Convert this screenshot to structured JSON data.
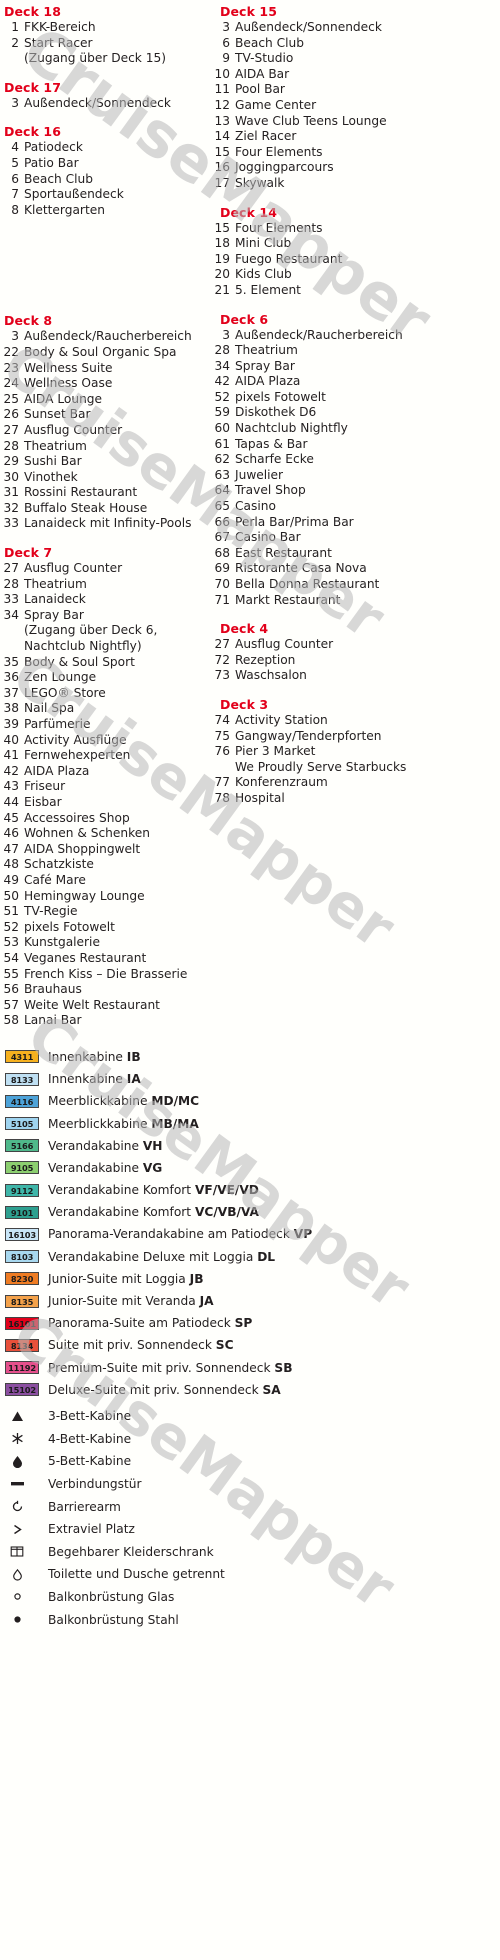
{
  "watermark": {
    "text": "CruiseMapper"
  },
  "colors": {
    "deck_heading": "#e2001a",
    "body_text": "#231f20",
    "background": "#fffffc"
  },
  "left_column": {
    "decks": [
      {
        "title": "Deck 18",
        "items": [
          {
            "num": "1",
            "label": "FKK-Bereich"
          },
          {
            "num": "2",
            "label": "Start Racer"
          },
          {
            "num": "",
            "label": "(Zugang über Deck 15)"
          }
        ]
      },
      {
        "title": "Deck 17",
        "items": [
          {
            "num": "3",
            "label": "Außendeck/Sonnendeck"
          }
        ]
      },
      {
        "title": "Deck 16",
        "items": [
          {
            "num": "4",
            "label": "Patiodeck"
          },
          {
            "num": "5",
            "label": "Patio Bar"
          },
          {
            "num": "6",
            "label": "Beach Club"
          },
          {
            "num": "7",
            "label": "Sportaußendeck"
          },
          {
            "num": "8",
            "label": "Klettergarten"
          }
        ]
      },
      {
        "title": "Deck 8",
        "items": [
          {
            "num": "3",
            "label": "Außendeck/Raucherbereich"
          },
          {
            "num": "22",
            "label": "Body & Soul Organic Spa"
          },
          {
            "num": "23",
            "label": "Wellness Suite"
          },
          {
            "num": "24",
            "label": "Wellness Oase"
          },
          {
            "num": "25",
            "label": "AIDA Lounge"
          },
          {
            "num": "26",
            "label": "Sunset Bar"
          },
          {
            "num": "27",
            "label": "Ausflug Counter"
          },
          {
            "num": "28",
            "label": "Theatrium"
          },
          {
            "num": "29",
            "label": "Sushi Bar"
          },
          {
            "num": "30",
            "label": "Vinothek"
          },
          {
            "num": "31",
            "label": "Rossini Restaurant"
          },
          {
            "num": "32",
            "label": "Buffalo Steak House"
          },
          {
            "num": "33",
            "label": "Lanaideck mit Infinity-Pools"
          }
        ]
      },
      {
        "title": "Deck 7",
        "items": [
          {
            "num": "27",
            "label": "Ausflug Counter"
          },
          {
            "num": "28",
            "label": "Theatrium"
          },
          {
            "num": "33",
            "label": "Lanaideck"
          },
          {
            "num": "34",
            "label": "Spray Bar"
          },
          {
            "num": "",
            "label": "(Zugang über Deck 6,"
          },
          {
            "num": "",
            "label": "Nachtclub Nightfly)"
          },
          {
            "num": "35",
            "label": "Body & Soul Sport"
          },
          {
            "num": "36",
            "label": "Zen Lounge"
          },
          {
            "num": "37",
            "label": "LEGO® Store"
          },
          {
            "num": "38",
            "label": "Nail Spa"
          },
          {
            "num": "39",
            "label": "Parfümerie"
          },
          {
            "num": "40",
            "label": "Activity Ausflüge"
          },
          {
            "num": "41",
            "label": "Fernwehexperten"
          },
          {
            "num": "42",
            "label": "AIDA Plaza"
          },
          {
            "num": "43",
            "label": "Friseur"
          },
          {
            "num": "44",
            "label": "Eisbar"
          },
          {
            "num": "45",
            "label": "Accessoires Shop"
          },
          {
            "num": "46",
            "label": "Wohnen & Schenken"
          },
          {
            "num": "47",
            "label": "AIDA Shoppingwelt"
          },
          {
            "num": "48",
            "label": "Schatzkiste"
          },
          {
            "num": "49",
            "label": "Café Mare"
          },
          {
            "num": "50",
            "label": "Hemingway Lounge"
          },
          {
            "num": "51",
            "label": "TV-Regie"
          },
          {
            "num": "52",
            "label": "pixels Fotowelt"
          },
          {
            "num": "53",
            "label": "Kunstgalerie"
          },
          {
            "num": "54",
            "label": "Veganes Restaurant"
          },
          {
            "num": "55",
            "label": "French Kiss – Die Brasserie"
          },
          {
            "num": "56",
            "label": "Brauhaus"
          },
          {
            "num": "57",
            "label": "Weite Welt Restaurant"
          },
          {
            "num": "58",
            "label": "Lanai Bar"
          }
        ]
      }
    ]
  },
  "right_column": {
    "decks": [
      {
        "title": "Deck 15",
        "items": [
          {
            "num": "3",
            "label": "Außendeck/Sonnendeck"
          },
          {
            "num": "6",
            "label": "Beach Club"
          },
          {
            "num": "9",
            "label": "TV-Studio"
          },
          {
            "num": "10",
            "label": "AIDA Bar"
          },
          {
            "num": "11",
            "label": "Pool Bar"
          },
          {
            "num": "12",
            "label": "Game Center"
          },
          {
            "num": "13",
            "label": "Wave Club Teens Lounge"
          },
          {
            "num": "14",
            "label": "Ziel Racer"
          },
          {
            "num": "15",
            "label": "Four Elements"
          },
          {
            "num": "16",
            "label": "Joggingparcours"
          },
          {
            "num": "17",
            "label": "Skywalk"
          }
        ]
      },
      {
        "title": "Deck 14",
        "items": [
          {
            "num": "15",
            "label": "Four Elements"
          },
          {
            "num": "18",
            "label": "Mini Club"
          },
          {
            "num": "19",
            "label": "Fuego Restaurant"
          },
          {
            "num": "20",
            "label": "Kids Club"
          },
          {
            "num": "21",
            "label": "5. Element"
          }
        ]
      },
      {
        "title": "Deck 6",
        "items": [
          {
            "num": "3",
            "label": "Außendeck/Raucherbereich"
          },
          {
            "num": "28",
            "label": "Theatrium"
          },
          {
            "num": "34",
            "label": "Spray Bar"
          },
          {
            "num": "42",
            "label": "AIDA Plaza"
          },
          {
            "num": "52",
            "label": "pixels Fotowelt"
          },
          {
            "num": "59",
            "label": "Diskothek D6"
          },
          {
            "num": "60",
            "label": "Nachtclub Nightfly"
          },
          {
            "num": "61",
            "label": "Tapas & Bar"
          },
          {
            "num": "62",
            "label": "Scharfe Ecke"
          },
          {
            "num": "63",
            "label": "Juwelier"
          },
          {
            "num": "64",
            "label": "Travel Shop"
          },
          {
            "num": "65",
            "label": "Casino"
          },
          {
            "num": "66",
            "label": "Perla Bar/Prima Bar"
          },
          {
            "num": "67",
            "label": "Casino Bar"
          },
          {
            "num": "68",
            "label": "East Restaurant"
          },
          {
            "num": "69",
            "label": "Ristorante Casa Nova"
          },
          {
            "num": "70",
            "label": "Bella Donna Restaurant"
          },
          {
            "num": "71",
            "label": "Markt Restaurant"
          }
        ]
      },
      {
        "title": "Deck 4",
        "items": [
          {
            "num": "27",
            "label": "Ausflug Counter"
          },
          {
            "num": "72",
            "label": "Rezeption"
          },
          {
            "num": "73",
            "label": "Waschsalon"
          }
        ]
      },
      {
        "title": "Deck 3",
        "items": [
          {
            "num": "74",
            "label": "Activity Station"
          },
          {
            "num": "75",
            "label": "Gangway/Tenderpforten"
          },
          {
            "num": "76",
            "label": "Pier 3 Market"
          },
          {
            "num": "",
            "label": "We Proudly Serve Starbucks"
          },
          {
            "num": "77",
            "label": "Konferenzraum"
          },
          {
            "num": "78",
            "label": "Hospital"
          }
        ]
      }
    ]
  },
  "cabin_legend": [
    {
      "code": "4311",
      "color": "#f6b11e",
      "text": "Innenkabine ",
      "bold": "IB"
    },
    {
      "code": "8133",
      "color": "#bfe0f2",
      "text": "Innenkabine ",
      "bold": "IA"
    },
    {
      "code": "4116",
      "color": "#4da3d8",
      "text": "Meerblickkabine ",
      "bold": "MD/MC"
    },
    {
      "code": "5105",
      "color": "#9fd4ef",
      "text": "Meerblickkabine ",
      "bold": "MB/MA"
    },
    {
      "code": "5166",
      "color": "#4fb98a",
      "text": "Verandakabine ",
      "bold": "VH"
    },
    {
      "code": "9105",
      "color": "#8ccf6f",
      "text": "Verandakabine ",
      "bold": "VG"
    },
    {
      "code": "9112",
      "color": "#3fb6a8",
      "text": "Verandakabine Komfort ",
      "bold": "VF/VE/VD"
    },
    {
      "code": "9101",
      "color": "#2ea08f",
      "text": "Verandakabine Komfort ",
      "bold": "VC/VB/VA"
    },
    {
      "code": "16103",
      "color": "#c9e6f7",
      "text": "Panorama-Verandakabine am Patiodeck ",
      "bold": "VP"
    },
    {
      "code": "8103",
      "color": "#a8d8ee",
      "text": "Verandakabine Deluxe mit Loggia ",
      "bold": "DL"
    },
    {
      "code": "8230",
      "color": "#ef7c22",
      "text": "Junior-Suite mit Loggia ",
      "bold": "JB"
    },
    {
      "code": "8135",
      "color": "#f4a24a",
      "text": "Junior-Suite mit Veranda ",
      "bold": "JA"
    },
    {
      "code": "16101",
      "color": "#e2001a",
      "text": "Panorama-Suite am Patiodeck ",
      "bold": "SP"
    },
    {
      "code": "8134",
      "color": "#e8503a",
      "text": "Suite mit priv. Sonnendeck ",
      "bold": "SC"
    },
    {
      "code": "11192",
      "color": "#e5508c",
      "text": "Premium-Suite mit priv. Sonnendeck ",
      "bold": "SB"
    },
    {
      "code": "15102",
      "color": "#8b4fa0",
      "text": "Deluxe-Suite mit priv. Sonnendeck ",
      "bold": "SA"
    }
  ],
  "symbol_legend": [
    {
      "icon": "triangle-icon",
      "glyph": "▲",
      "label": "3-Bett-Kabine"
    },
    {
      "icon": "asterisk-icon",
      "glyph": "✶",
      "label": "4-Bett-Kabine"
    },
    {
      "icon": "diamond-drop-icon",
      "glyph": "◆",
      "label": "5-Bett-Kabine"
    },
    {
      "icon": "connecting-door-icon",
      "glyph": "▭",
      "label": "Verbindungstür"
    },
    {
      "icon": "accessible-icon",
      "glyph": "↺",
      "label": "Barrierearm"
    },
    {
      "icon": "extra-space-icon",
      "glyph": ">",
      "label": "Extraviel Platz"
    },
    {
      "icon": "wardrobe-icon",
      "glyph": "▤",
      "label": "Begehbarer Kleiderschrank"
    },
    {
      "icon": "split-bath-icon",
      "glyph": "△",
      "label": "Toilette und Dusche getrennt"
    },
    {
      "icon": "glass-railing-icon",
      "glyph": "○",
      "label": "Balkonbrüstung Glas"
    },
    {
      "icon": "steel-railing-icon",
      "glyph": "●",
      "label": "Balkonbrüstung Stahl"
    }
  ]
}
